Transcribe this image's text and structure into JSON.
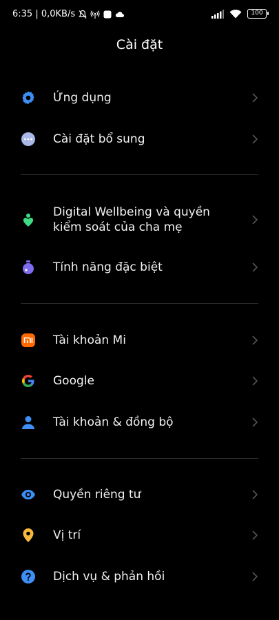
{
  "status": {
    "time_net": "6:35 | 0,0KB/s",
    "battery": "100"
  },
  "title": "Cài đặt",
  "items": [
    {
      "label": "Ứng dụng"
    },
    {
      "label": "Cài đặt bổ sung"
    },
    {
      "label": "Digital Wellbeing và quyền kiểm soát của cha mẹ"
    },
    {
      "label": "Tính năng đặc biệt"
    },
    {
      "label": "Tài khoản Mi"
    },
    {
      "label": "Google"
    },
    {
      "label": "Tài khoản & đồng bộ"
    },
    {
      "label": "Quyền riêng tư"
    },
    {
      "label": "Vị trí"
    },
    {
      "label": "Dịch vụ & phản hồi"
    }
  ],
  "icons": [
    "gear-icon",
    "more-dots-icon",
    "wellbeing-icon",
    "special-features-icon",
    "mi-account-icon",
    "google-icon",
    "account-sync-icon",
    "privacy-eye-icon",
    "location-pin-icon",
    "help-icon"
  ],
  "colors": {
    "background": "#000000",
    "accent_blue": "#3d8ff5",
    "mi_orange": "#ff6900",
    "wellbeing_green": "#3ddc84",
    "special_purple": "#7e6cf0",
    "location_yellow": "#f6b93b"
  }
}
